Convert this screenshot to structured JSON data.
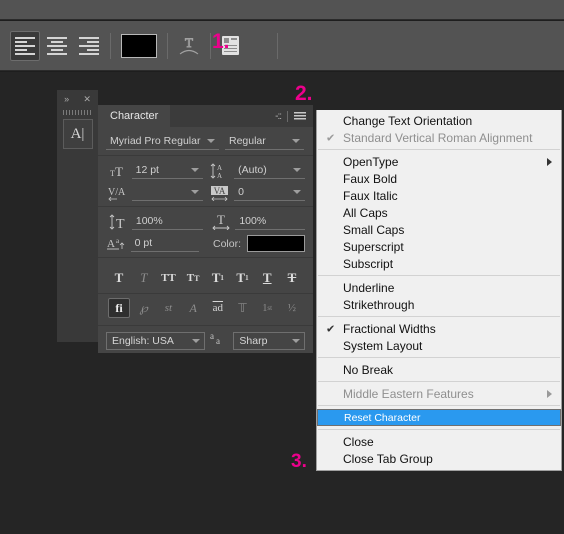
{
  "toolbar": {
    "align_left_label": "align-left",
    "align_center_label": "align-center",
    "align_right_label": "align-right",
    "text_color_label": "Text Color",
    "text_color_hex": "#000000",
    "warp_label": "Create warped text",
    "panel_toggle_label": "Toggle the Character and Paragraph panels"
  },
  "annotations": {
    "one": "1.",
    "two": "2.",
    "three": "3.",
    "color": "#ec008c"
  },
  "dock": {
    "expand_label": "»",
    "close_label": "✕",
    "tool_icon_label": "A|"
  },
  "character_panel": {
    "tab_label": "Character",
    "collapse_label": "-::",
    "menu_label": "panel-menu",
    "font_family": "Myriad Pro Regular",
    "font_style": "Regular",
    "font_size": "12 pt",
    "leading": "(Auto)",
    "kerning": "",
    "tracking": "0",
    "vertical_scale": "100%",
    "horizontal_scale": "100%",
    "baseline_shift": "0 pt",
    "color_label": "Color:",
    "color_hex": "#000000",
    "style_buttons": [
      {
        "glyph": "T",
        "name": "faux-bold",
        "state": "normal"
      },
      {
        "glyph": "T",
        "name": "faux-italic",
        "state": "dim"
      },
      {
        "glyph": "TT",
        "name": "all-caps",
        "state": "normal"
      },
      {
        "glyph": "Tт",
        "name": "small-caps",
        "state": "normal"
      },
      {
        "glyph": "T¹",
        "name": "superscript",
        "state": "normal"
      },
      {
        "glyph": "T₁",
        "name": "subscript",
        "state": "normal"
      },
      {
        "glyph": "T",
        "name": "underline",
        "state": "normal"
      },
      {
        "glyph": "T",
        "name": "strikethrough",
        "state": "normal"
      }
    ],
    "ot_buttons": [
      {
        "glyph": "fi",
        "name": "standard-ligatures",
        "state": "on"
      },
      {
        "glyph": "℘",
        "name": "contextual-alternates",
        "state": "dim"
      },
      {
        "glyph": "st",
        "name": "discretionary-ligatures",
        "state": "dim"
      },
      {
        "glyph": "𝒜",
        "name": "swash",
        "state": "dim"
      },
      {
        "glyph": "aa",
        "name": "oldstyle",
        "state": "dim"
      },
      {
        "glyph": "T",
        "name": "titling-alternates",
        "state": "dim"
      },
      {
        "glyph": "1st",
        "name": "ordinals",
        "state": "dim"
      },
      {
        "glyph": "½",
        "name": "fractions",
        "state": "dim"
      }
    ],
    "language": "English: USA",
    "antialias_icon_label": "aa",
    "antialias": "Sharp"
  },
  "context_menu": {
    "items": [
      {
        "label": "Change Text Orientation",
        "checked": false,
        "disabled": false,
        "submenu": false,
        "selected": false
      },
      {
        "label": "Standard Vertical Roman Alignment",
        "checked": true,
        "disabled": true,
        "submenu": false,
        "selected": false
      },
      {
        "separator": true
      },
      {
        "label": "OpenType",
        "checked": false,
        "disabled": false,
        "submenu": true,
        "selected": false
      },
      {
        "label": "Faux Bold",
        "checked": false,
        "disabled": false,
        "submenu": false,
        "selected": false
      },
      {
        "label": "Faux Italic",
        "checked": false,
        "disabled": false,
        "submenu": false,
        "selected": false
      },
      {
        "label": "All Caps",
        "checked": false,
        "disabled": false,
        "submenu": false,
        "selected": false
      },
      {
        "label": "Small Caps",
        "checked": false,
        "disabled": false,
        "submenu": false,
        "selected": false
      },
      {
        "label": "Superscript",
        "checked": false,
        "disabled": false,
        "submenu": false,
        "selected": false
      },
      {
        "label": "Subscript",
        "checked": false,
        "disabled": false,
        "submenu": false,
        "selected": false
      },
      {
        "separator": true
      },
      {
        "label": "Underline",
        "checked": false,
        "disabled": false,
        "submenu": false,
        "selected": false
      },
      {
        "label": "Strikethrough",
        "checked": false,
        "disabled": false,
        "submenu": false,
        "selected": false
      },
      {
        "separator": true
      },
      {
        "label": "Fractional Widths",
        "checked": true,
        "disabled": false,
        "submenu": false,
        "selected": false
      },
      {
        "label": "System Layout",
        "checked": false,
        "disabled": false,
        "submenu": false,
        "selected": false
      },
      {
        "separator": true
      },
      {
        "label": "No Break",
        "checked": false,
        "disabled": false,
        "submenu": false,
        "selected": false
      },
      {
        "separator": true
      },
      {
        "label": "Middle Eastern Features",
        "checked": false,
        "disabled": true,
        "submenu": true,
        "selected": false
      },
      {
        "separator": true
      },
      {
        "label": "Reset Character",
        "checked": false,
        "disabled": false,
        "submenu": false,
        "selected": true
      },
      {
        "separator": true
      },
      {
        "label": "Close",
        "checked": false,
        "disabled": false,
        "submenu": false,
        "selected": false
      },
      {
        "label": "Close Tab Group",
        "checked": false,
        "disabled": false,
        "submenu": false,
        "selected": false
      }
    ],
    "highlight_color": "#2a99ef",
    "check_glyph": "✔"
  }
}
